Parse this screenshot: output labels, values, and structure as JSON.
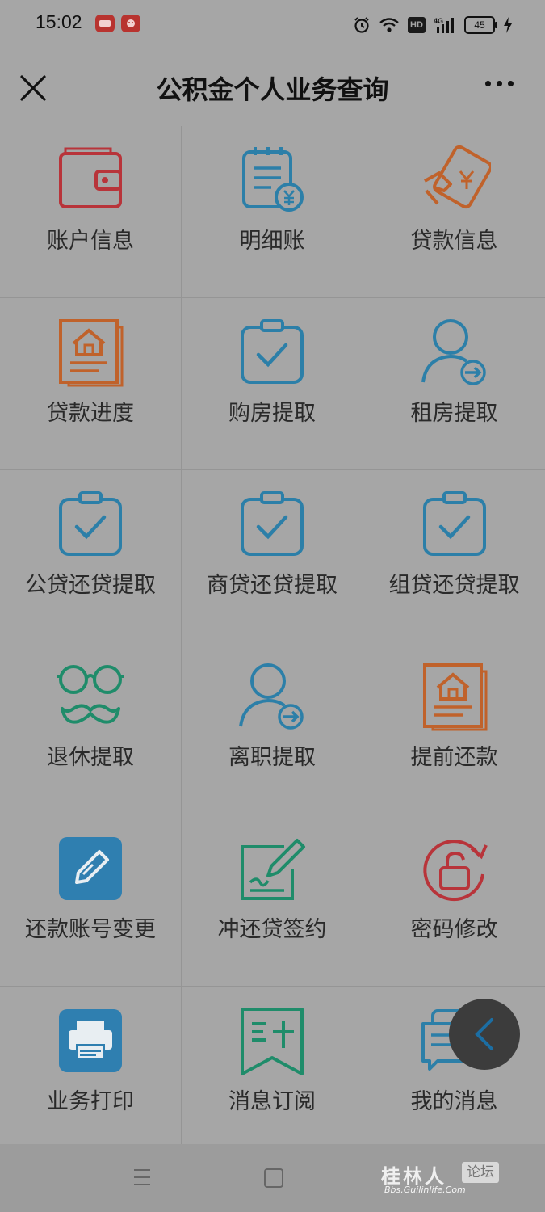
{
  "status_bar": {
    "time": "15:02",
    "hd": "HD",
    "network": "4G",
    "battery": "45"
  },
  "header": {
    "title": "公积金个人业务查询"
  },
  "grid": {
    "items": [
      {
        "label": "账户信息",
        "icon": "wallet-icon",
        "color": "#b8343a"
      },
      {
        "label": "明细账",
        "icon": "ledger-yuan-icon",
        "color": "#2c7fa8"
      },
      {
        "label": "贷款信息",
        "icon": "loan-card-icon",
        "color": "#c0622b"
      },
      {
        "label": "贷款进度",
        "icon": "house-document-icon",
        "color": "#c0622b"
      },
      {
        "label": "购房提取",
        "icon": "clipboard-check-icon",
        "color": "#2c7fa8"
      },
      {
        "label": "租房提取",
        "icon": "user-arrow-icon",
        "color": "#2c7fa8"
      },
      {
        "label": "公贷还贷提取",
        "icon": "clipboard-check-icon",
        "color": "#2c7fa8"
      },
      {
        "label": "商贷还贷提取",
        "icon": "clipboard-check-icon",
        "color": "#2c7fa8"
      },
      {
        "label": "组贷还贷提取",
        "icon": "clipboard-check-icon",
        "color": "#2c7fa8"
      },
      {
        "label": "退休提取",
        "icon": "glasses-mustache-icon",
        "color": "#1f8c6a"
      },
      {
        "label": "离职提取",
        "icon": "user-arrow-icon",
        "color": "#2c7fa8"
      },
      {
        "label": "提前还款",
        "icon": "house-document-icon",
        "color": "#c0622b"
      },
      {
        "label": "还款账号变更",
        "icon": "edit-square-icon",
        "color": "#2f7fb0"
      },
      {
        "label": "冲还贷签约",
        "icon": "sign-pen-icon",
        "color": "#1f8c6a"
      },
      {
        "label": "密码修改",
        "icon": "unlock-refresh-icon",
        "color": "#b8343a"
      },
      {
        "label": "业务打印",
        "icon": "printer-icon",
        "color": "#2f7fb0"
      },
      {
        "label": "消息订阅",
        "icon": "subscribe-flag-icon",
        "color": "#1f8c6a"
      },
      {
        "label": "我的消息",
        "icon": "message-icon",
        "color": "#2c7fa8"
      }
    ]
  },
  "watermark": {
    "main": "桂林人",
    "tag": "论坛",
    "url": "Bbs.Guilinlife.Com"
  }
}
